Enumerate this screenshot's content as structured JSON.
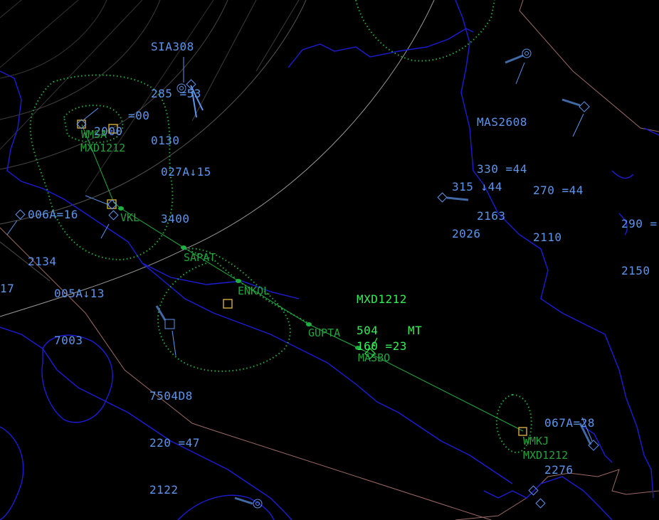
{
  "colors": {
    "background": "#000000",
    "coastline": "#1a1ad2",
    "fir_boundary": "#9a6a66",
    "range_rings": "#cfcfcf",
    "route": "#1fae40",
    "label_blue": "#5c95ec",
    "label_green": "#23a23e",
    "selected_label": "#33ee55",
    "airport_box": "#c8a23a"
  },
  "tracks": [
    {
      "id": "sia308",
      "icon": "track-target-icon",
      "lines": [
        "SIA308",
        "285 =53",
        "0130"
      ]
    },
    {
      "id": "f2000",
      "icon": "track-target-icon",
      "lines": [
        "2000"
      ]
    },
    {
      "id": "f00",
      "icon": "track-target-icon",
      "lines": [
        "=00"
      ]
    },
    {
      "id": "f027a",
      "icon": "track-target-icon",
      "lines": [
        "027A↓15",
        "3400"
      ]
    },
    {
      "id": "f006a",
      "icon": "track-target-icon",
      "lines": [
        "006A=16",
        "2134"
      ]
    },
    {
      "id": "f005a",
      "icon": "track-target-icon",
      "lines": [
        "005A↓13",
        "7003"
      ]
    },
    {
      "id": "f17",
      "icon": "track-target-icon",
      "lines": [
        "17"
      ]
    },
    {
      "id": "mas2608",
      "icon": "track-target-icon",
      "lines": [
        "MAS2608",
        "330 =44",
        "2163"
      ]
    },
    {
      "id": "f315",
      "icon": "track-target-icon",
      "lines": [
        "315 ↓44",
        "2026"
      ]
    },
    {
      "id": "f270",
      "icon": "track-target-icon",
      "lines": [
        "270 =44",
        "2110"
      ]
    },
    {
      "id": "f290",
      "icon": "track-target-icon",
      "lines": [
        "290 =",
        "2150"
      ]
    },
    {
      "id": "f7504",
      "icon": "track-target-icon",
      "lines": [
        "7504D8",
        "220 =47",
        "2122"
      ]
    },
    {
      "id": "f067a",
      "icon": "track-target-icon",
      "lines": [
        "067A=28",
        "2276"
      ]
    }
  ],
  "selected": {
    "callsign": "MXD1212",
    "level": "160 =23",
    "sub_left": "504",
    "sub_right": "MT"
  },
  "waypoints": {
    "wmsa": "WMSA",
    "wmsa_flight": "MXD1212",
    "vkl": "VKL",
    "sapat": "SAPAT",
    "enkol": "ENKOL",
    "gupta": "GUPTA",
    "masbo": "MASBO",
    "wmkj": "WMKJ",
    "wmkj_flight": "MXD1212"
  }
}
